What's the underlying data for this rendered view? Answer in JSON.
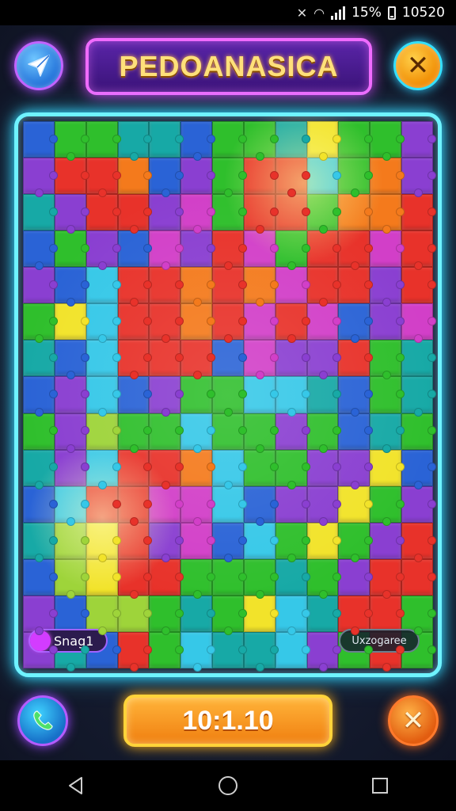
{
  "status_bar": {
    "battery_pct": "15%",
    "clock": "10520",
    "icons": [
      "mute-icon",
      "wifi-icon",
      "signal-icon",
      "battery-icon"
    ]
  },
  "header": {
    "title": "PEDOANASICA",
    "left_button_icon": "send-icon",
    "right_button_icon": "close-icon"
  },
  "board": {
    "rows": 15,
    "cols": 13,
    "palette": {
      "R": "#e8322a",
      "O": "#f47a1c",
      "Y": "#f2e32a",
      "G": "#2fbf2c",
      "T": "#17a9a6",
      "C": "#36c8e8",
      "B": "#2a63d6",
      "P": "#8a3fd1",
      "M": "#d23fc8",
      "L": "#9ed43a"
    },
    "pieces": [
      "BGGTTBGGTYGGP",
      "PRROBPGRRCGOP",
      "TPRRPMGRRGOOR",
      "BGPBMPRMGRRMR",
      "PBCRROROMRRPR",
      "GYCRRORMRMBPM",
      "TBCRRRBMPPRGT",
      "BPCBPGGCCTBGT",
      "GPLGGCGGPGBTG",
      "TPCRROCGGPPYB",
      "BCRRMMCBPPYGP",
      "TLYRPMBCGYGPR",
      "BLYRRGGGTGPRR",
      "PBLLGTGYCTRRG",
      "PTBRGCTTCPGRG"
    ],
    "chip_left": "Snag1",
    "chip_right": "Uxzogaree"
  },
  "footer": {
    "timer": "10:1.10",
    "left_button_icon": "phone-icon",
    "right_button_icon": "close-icon"
  },
  "navbar": {
    "icons": [
      "back-icon",
      "home-icon",
      "recents-icon"
    ]
  }
}
